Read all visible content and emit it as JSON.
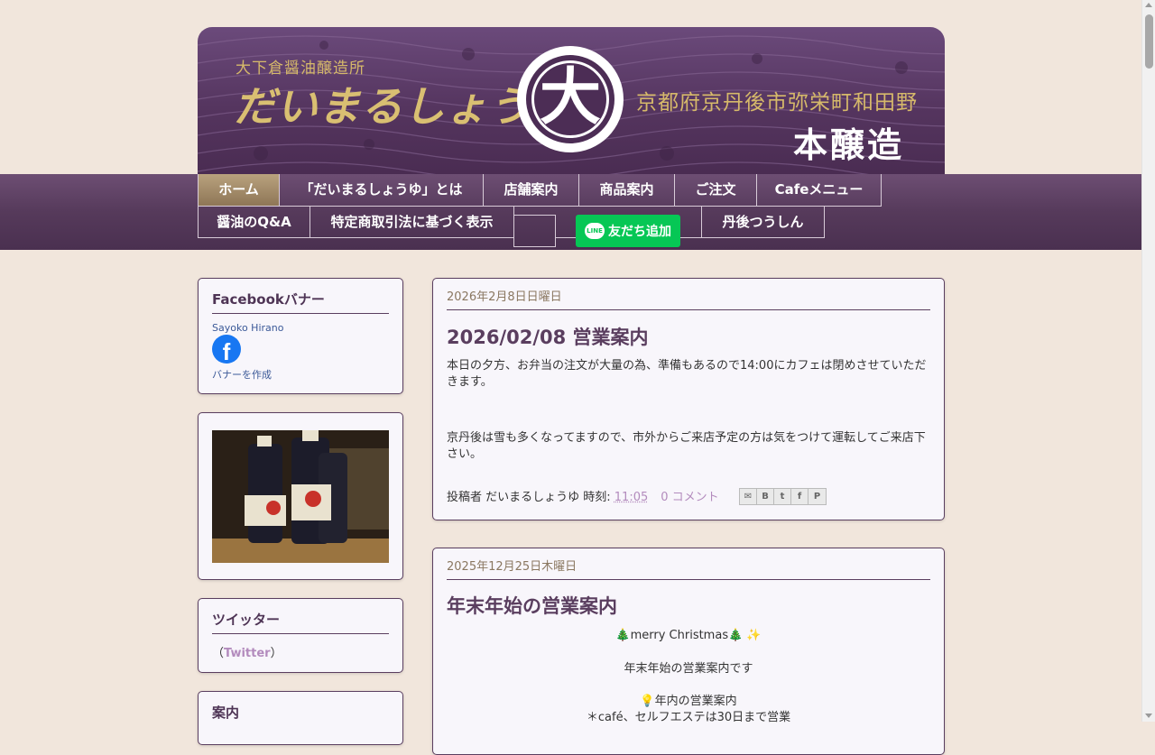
{
  "header": {
    "brand_sub": "大下倉醤油醸造所",
    "brand_main": "だいまるしょうゆ",
    "logo_kanji": "大",
    "address": "京都府京丹後市弥栄町和田野",
    "tagline": "本醸造"
  },
  "nav": {
    "row1": [
      "ホーム",
      "「だいまるしょうゆ」とは",
      "店舗案内",
      "商品案内",
      "ご注文",
      "Cafeメニュー"
    ],
    "row2": [
      "醤油のQ&A",
      "特定商取引法に基づく表示",
      "丹後つうしん"
    ],
    "line_button": "友だち追加",
    "line_icon": "LINE"
  },
  "sidebar": {
    "facebook": {
      "title": "Facebookバナー",
      "name": "Sayoko Hirano",
      "icon": "f",
      "make_banner": "バナーを作成"
    },
    "twitter": {
      "title": "ツイッター",
      "open": "（",
      "link": "Twitter",
      "close": "）"
    },
    "guide": {
      "title": "案内"
    }
  },
  "posts": [
    {
      "date": "2026年2月8日日曜日",
      "title": "2026/02/08 営業案内",
      "body1": " 本日の夕方、お弁当の注文が大量の為、準備もあるので14:00にカフェは閉めさせていただきます。",
      "body2": "京丹後は雪も多くなってますので、市外からご来店予定の方は気をつけて運転してご来店下さい。",
      "posted_by": "投稿者 だいまるしょうゆ 時刻: ",
      "time": "11:05",
      "comments": "0 コメント"
    },
    {
      "date": "2025年12月25日木曜日",
      "title": "年末年始の営業案内",
      "line1": "🎄merry Christmas🎄 ✨",
      "line2": "年末年始の営業案内です",
      "line3": "💡年内の営業案内",
      "line4": "＊café、セルフエステは30日まで営業"
    }
  ],
  "colors": {
    "background": "#f1e6dc",
    "header_purple": "#55355f",
    "accent_gold": "#d9bf72",
    "link_purple": "#b38bbd",
    "line_green": "#06c755"
  }
}
